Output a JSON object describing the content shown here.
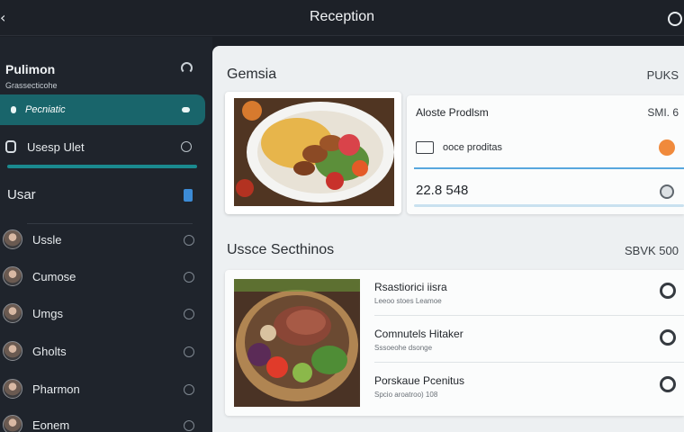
{
  "header": {
    "title": "Reception",
    "back_icon": "chevron-left-icon",
    "right_icon": "circle-icon"
  },
  "sidebar": {
    "title": "Pulimon",
    "subtitle": "Grassecticohe",
    "active_item": "Pecniatic",
    "user_row": "Usesp Ulet",
    "section": "Usar",
    "list": [
      {
        "label": "Ussle"
      },
      {
        "label": "Cumose"
      },
      {
        "label": "Umgs"
      },
      {
        "label": "Gholts"
      },
      {
        "label": "Pharmon"
      },
      {
        "label": "Eonem"
      }
    ]
  },
  "main": {
    "title": "Gemsia",
    "title_right": "PUKS",
    "panel1": {
      "heading": "Aloste Prodlsm",
      "heading_value": "SMI. 6",
      "row_label": "ooce proditas",
      "number": "22.8 548",
      "accent_color": "#f08a3c",
      "line_color": "#57a7de"
    },
    "section2": {
      "title": "Ussce Secthinos",
      "right": "SBVK 500",
      "rows": [
        {
          "title": "Rsastiorici iisra",
          "sub": "Leeoo stoes Leamoe"
        },
        {
          "title": "Comnutels Hitaker",
          "sub": "Sssoeohe dsonge"
        },
        {
          "title": "Porskaue Pcenitus",
          "sub": "Spcio aroatroo) 108"
        }
      ]
    }
  },
  "colors": {
    "sidebar_active": "#19656b",
    "teal_progress": "#1a8a8f",
    "content_bg": "#edf0f2"
  }
}
